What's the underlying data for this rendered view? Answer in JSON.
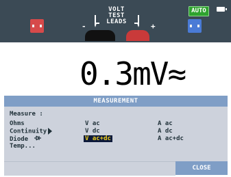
{
  "status": {
    "title_line1": "VOLT",
    "title_line2": "TEST",
    "title_line3": "LEADS",
    "auto_label": "AUTO",
    "minus_sign": "-",
    "plus_sign": "+"
  },
  "display": {
    "reading": "0.3mV≈"
  },
  "menu": {
    "title": "MEASUREMENT",
    "heading": "Measure :",
    "items": [
      [
        "Ohms",
        "V ac",
        "A ac"
      ],
      [
        "Continuity",
        "V dc",
        "A dc"
      ],
      [
        "Diode",
        "V ac+dc",
        "A ac+dc"
      ],
      [
        "Temp...",
        "",
        ""
      ]
    ],
    "selected": "V ac+dc",
    "close_label": "CLOSE"
  },
  "colors": {
    "top_band": "#3b4a55",
    "menu_bg": "#cdd2dc",
    "accent": "#7f9ec6",
    "highlight_bg": "#0d1a3a",
    "highlight_fg": "#f0d020",
    "auto_green": "#2fa32f"
  },
  "icons": {
    "battery": "battery-icon",
    "probe_left": "probe-red-icon",
    "probe_right": "probe-blue-icon",
    "submenu": "triangle-right-icon",
    "diode": "diode-icon"
  }
}
